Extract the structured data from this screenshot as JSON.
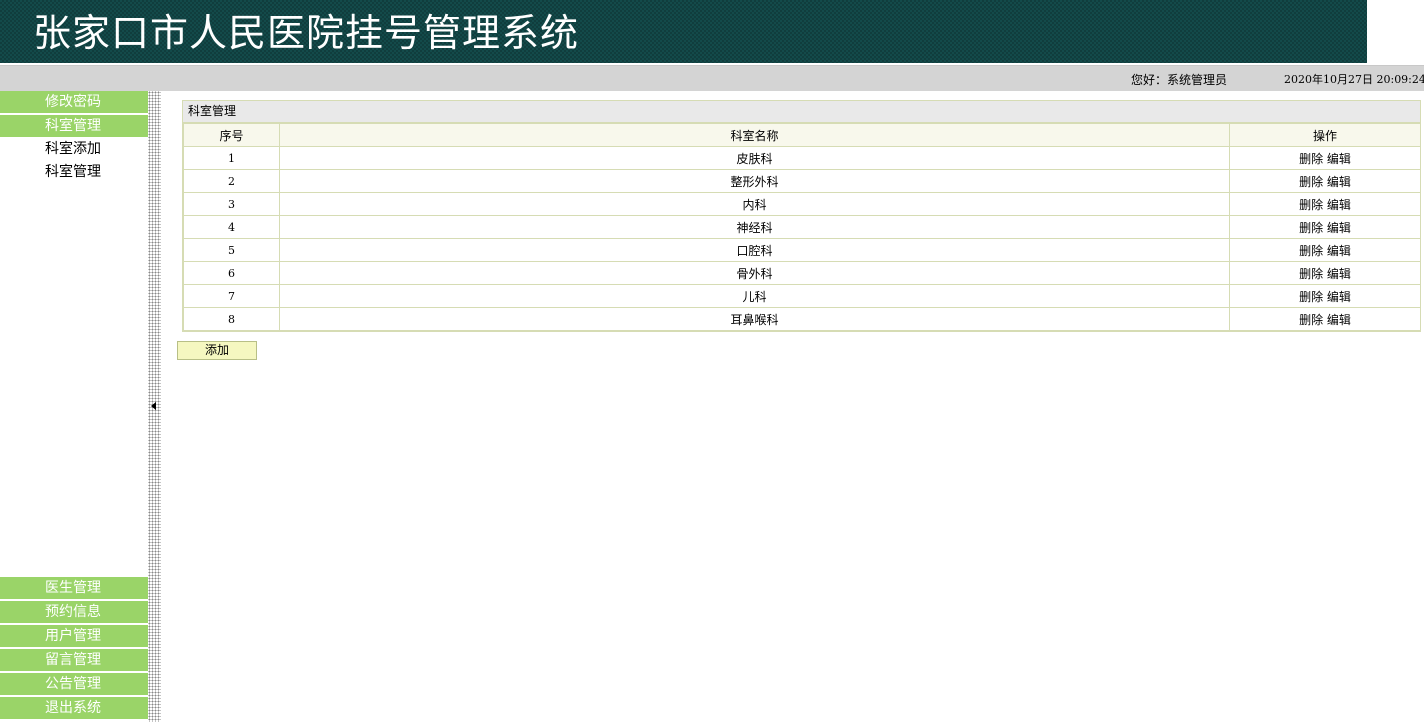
{
  "header": {
    "title": "张家口市人民医院挂号管理系统"
  },
  "infobar": {
    "greeting": "您好：系统管理员",
    "datetime": "2020年10月27日  20:09:24"
  },
  "sidebar": {
    "top_menus": [
      {
        "label": "修改密码"
      },
      {
        "label": "科室管理"
      }
    ],
    "sub_items": [
      {
        "label": "科室添加"
      },
      {
        "label": "科室管理"
      }
    ],
    "bottom_menus": [
      {
        "label": "医生管理"
      },
      {
        "label": "预约信息"
      },
      {
        "label": "用户管理"
      },
      {
        "label": "留言管理"
      },
      {
        "label": "公告管理"
      },
      {
        "label": "退出系统"
      }
    ]
  },
  "panel": {
    "title": "科室管理",
    "columns": [
      "序号",
      "科室名称",
      "操作"
    ],
    "rows": [
      {
        "no": "1",
        "name": "皮肤科"
      },
      {
        "no": "2",
        "name": "整形外科"
      },
      {
        "no": "3",
        "name": "内科"
      },
      {
        "no": "4",
        "name": "神经科"
      },
      {
        "no": "5",
        "name": "口腔科"
      },
      {
        "no": "6",
        "name": "骨外科"
      },
      {
        "no": "7",
        "name": "儿科"
      },
      {
        "no": "8",
        "name": "耳鼻喉科"
      }
    ],
    "delete_label": "删除",
    "edit_label": "编辑",
    "add_label": "添加"
  },
  "colors": {
    "banner": "#134a4a",
    "menu_green": "#9ad468",
    "info_bar": "#d4d4d4",
    "add_button": "#f5f7c0"
  }
}
